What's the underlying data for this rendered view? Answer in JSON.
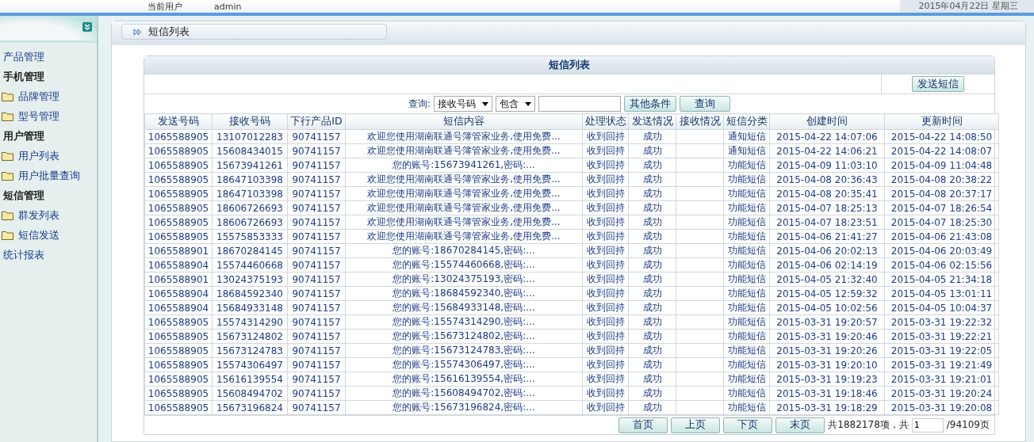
{
  "header": {
    "user_label": "当前用户",
    "user_name": "admin",
    "date": "2015年04月22日 星期三"
  },
  "sidebar": {
    "items": [
      {
        "kind": "link",
        "label": "产品管理"
      },
      {
        "kind": "group",
        "label": "手机管理"
      },
      {
        "kind": "folder",
        "label": "品牌管理"
      },
      {
        "kind": "folder",
        "label": "型号管理"
      },
      {
        "kind": "group",
        "label": "用户管理"
      },
      {
        "kind": "folder",
        "label": "用户列表"
      },
      {
        "kind": "folder",
        "label": "用户批量查询"
      },
      {
        "kind": "group",
        "label": "短信管理"
      },
      {
        "kind": "folder",
        "label": "群发列表"
      },
      {
        "kind": "folder",
        "label": "短信发送"
      },
      {
        "kind": "link",
        "label": "统计报表"
      }
    ]
  },
  "breadcrumb": "短信列表",
  "panel": {
    "title": "短信列表",
    "send_button": "发送短信",
    "query": {
      "label": "查询:",
      "field": "接收号码",
      "operator": "包含",
      "more_button": "其他条件",
      "search_button": "查询"
    },
    "table": {
      "columns": [
        "发送号码",
        "接收号码",
        "下行产品ID",
        "短信内容",
        "处理状态",
        "发送情况",
        "接收情况",
        "短信分类",
        "创建时间",
        "更新时间"
      ],
      "rows": [
        {
          "sender": "1065588905",
          "receiver": "13107012283",
          "product_id": "90741157",
          "content": "欢迎您使用湖南联通号簿管家业务,使用免费...",
          "process": "收到回持",
          "send": "成功",
          "category": "通知短信",
          "created": "2015-04-22 14:07:06",
          "updated": "2015-04-22 14:08:50"
        },
        {
          "sender": "1065588905",
          "receiver": "15608434015",
          "product_id": "90741157",
          "content": "欢迎您使用湖南联通号簿管家业务,使用免费...",
          "process": "收到回持",
          "send": "成功",
          "category": "通知短信",
          "created": "2015-04-22 14:06:21",
          "updated": "2015-04-22 14:08:07"
        },
        {
          "sender": "1065588905",
          "receiver": "15673941261",
          "product_id": "90741157",
          "content": "您的账号:15673941261,密码:...",
          "process": "收到回持",
          "send": "成功",
          "category": "功能短信",
          "created": "2015-04-09 11:03:10",
          "updated": "2015-04-09 11:04:48"
        },
        {
          "sender": "1065588905",
          "receiver": "18647103398",
          "product_id": "90741157",
          "content": "欢迎您使用湖南联通号簿管家业务,使用免费...",
          "process": "收到回持",
          "send": "成功",
          "category": "功能短信",
          "created": "2015-04-08 20:36:43",
          "updated": "2015-04-08 20:38:22"
        },
        {
          "sender": "1065588905",
          "receiver": "18647103398",
          "product_id": "90741157",
          "content": "欢迎您使用湖南联通号簿管家业务,使用免费...",
          "process": "收到回持",
          "send": "成功",
          "category": "功能短信",
          "created": "2015-04-08 20:35:41",
          "updated": "2015-04-08 20:37:17"
        },
        {
          "sender": "1065588905",
          "receiver": "18606726693",
          "product_id": "90741157",
          "content": "欢迎您使用湖南联通号簿管家业务,使用免费...",
          "process": "收到回持",
          "send": "成功",
          "category": "功能短信",
          "created": "2015-04-07 18:25:13",
          "updated": "2015-04-07 18:26:54"
        },
        {
          "sender": "1065588905",
          "receiver": "18606726693",
          "product_id": "90741157",
          "content": "欢迎您使用湖南联通号簿管家业务,使用免费...",
          "process": "收到回持",
          "send": "成功",
          "category": "功能短信",
          "created": "2015-04-07 18:23:51",
          "updated": "2015-04-07 18:25:30"
        },
        {
          "sender": "1065588905",
          "receiver": "15575853333",
          "product_id": "90741157",
          "content": "欢迎您使用湖南联通号簿管家业务,使用免费...",
          "process": "收到回持",
          "send": "成功",
          "category": "功能短信",
          "created": "2015-04-06 21:41:27",
          "updated": "2015-04-06 21:43:08"
        },
        {
          "sender": "1065588901",
          "receiver": "18670284145",
          "product_id": "90741157",
          "content": "您的账号:18670284145,密码:...",
          "process": "收到回持",
          "send": "成功",
          "category": "功能短信",
          "created": "2015-04-06 20:02:13",
          "updated": "2015-04-06 20:03:49"
        },
        {
          "sender": "1065588904",
          "receiver": "15574460668",
          "product_id": "90741157",
          "content": "您的账号:15574460668,密码:...",
          "process": "收到回持",
          "send": "成功",
          "category": "功能短信",
          "created": "2015-04-06 02:14:19",
          "updated": "2015-04-06 02:15:56"
        },
        {
          "sender": "1065588901",
          "receiver": "13024375193",
          "product_id": "90741157",
          "content": "您的账号:13024375193,密码:...",
          "process": "收到回持",
          "send": "成功",
          "category": "功能短信",
          "created": "2015-04-05 21:32:40",
          "updated": "2015-04-05 21:34:18"
        },
        {
          "sender": "1065588904",
          "receiver": "18684592340",
          "product_id": "90741157",
          "content": "您的账号:18684592340,密码:...",
          "process": "收到回持",
          "send": "成功",
          "category": "功能短信",
          "created": "2015-04-05 12:59:32",
          "updated": "2015-04-05 13:01:11"
        },
        {
          "sender": "1065588904",
          "receiver": "15684933148",
          "product_id": "90741157",
          "content": "您的账号:15684933148,密码:...",
          "process": "收到回持",
          "send": "成功",
          "category": "功能短信",
          "created": "2015-04-05 10:02:56",
          "updated": "2015-04-05 10:04:37"
        },
        {
          "sender": "1065588905",
          "receiver": "15574314290",
          "product_id": "90741157",
          "content": "您的账号:15574314290,密码:...",
          "process": "收到回持",
          "send": "成功",
          "category": "功能短信",
          "created": "2015-03-31 19:20:57",
          "updated": "2015-03-31 19:22:32"
        },
        {
          "sender": "1065588905",
          "receiver": "15673124802",
          "product_id": "90741157",
          "content": "您的账号:15673124802,密码:...",
          "process": "收到回持",
          "send": "成功",
          "category": "功能短信",
          "created": "2015-03-31 19:20:46",
          "updated": "2015-03-31 19:22:21"
        },
        {
          "sender": "1065588905",
          "receiver": "15673124783",
          "product_id": "90741157",
          "content": "您的账号:15673124783,密码:...",
          "process": "收到回持",
          "send": "成功",
          "category": "功能短信",
          "created": "2015-03-31 19:20:26",
          "updated": "2015-03-31 19:22:05"
        },
        {
          "sender": "1065588905",
          "receiver": "15574306497",
          "product_id": "90741157",
          "content": "您的账号:15574306497,密码:...",
          "process": "收到回持",
          "send": "成功",
          "category": "功能短信",
          "created": "2015-03-31 19:20:10",
          "updated": "2015-03-31 19:21:49"
        },
        {
          "sender": "1065588905",
          "receiver": "15616139554",
          "product_id": "90741157",
          "content": "您的账号:15616139554,密码:...",
          "process": "收到回持",
          "send": "成功",
          "category": "功能短信",
          "created": "2015-03-31 19:19:23",
          "updated": "2015-03-31 19:21:01"
        },
        {
          "sender": "1065588905",
          "receiver": "15608494702",
          "product_id": "90741157",
          "content": "您的账号:15608494702,密码:...",
          "process": "收到回持",
          "send": "成功",
          "category": "功能短信",
          "created": "2015-03-31 19:18:46",
          "updated": "2015-03-31 19:20:24"
        },
        {
          "sender": "1065588905",
          "receiver": "15673196824",
          "product_id": "90741157",
          "content": "您的账号:15673196824,密码:...",
          "process": "收到回持",
          "send": "成功",
          "category": "功能短信",
          "created": "2015-03-31 19:18:29",
          "updated": "2015-03-31 19:20:08"
        }
      ]
    },
    "pagination": {
      "buttons": [
        "首页",
        "上页",
        "下页",
        "末页"
      ],
      "total": "共1882178项，共",
      "page": "1",
      "pages": "/94109页"
    }
  }
}
